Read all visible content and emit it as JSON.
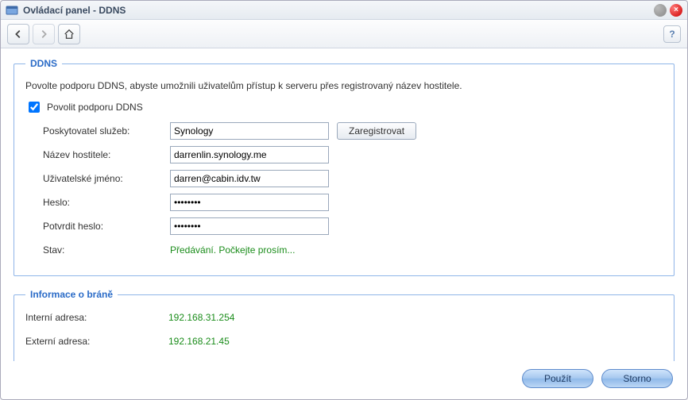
{
  "window": {
    "title": "Ovládací panel - DDNS"
  },
  "ddns": {
    "legend": "DDNS",
    "description": "Povolte podporu DDNS, abyste umožnili uživatelům přístup k serveru přes registrovaný název hostitele.",
    "enable_label": "Povolit podporu DDNS",
    "provider_label": "Poskytovatel služeb:",
    "provider_value": "Synology",
    "register_button": "Zaregistrovat",
    "hostname_label": "Název hostitele:",
    "hostname_value": "darrenlin.synology.me",
    "username_label": "Uživatelské jméno:",
    "username_value": "darren@cabin.idv.tw",
    "password_label": "Heslo:",
    "password_value": "••••••••",
    "confirm_label": "Potvrdit heslo:",
    "confirm_value": "••••••••",
    "status_label": "Stav:",
    "status_value": "Předávání. Počkejte prosím..."
  },
  "gateway": {
    "legend": "Informace o bráně",
    "internal_label": "Interní adresa:",
    "internal_value": "192.168.31.254",
    "external_label": "Externí adresa:",
    "external_value": "192.168.21.45"
  },
  "footer": {
    "apply": "Použít",
    "cancel": "Storno"
  }
}
